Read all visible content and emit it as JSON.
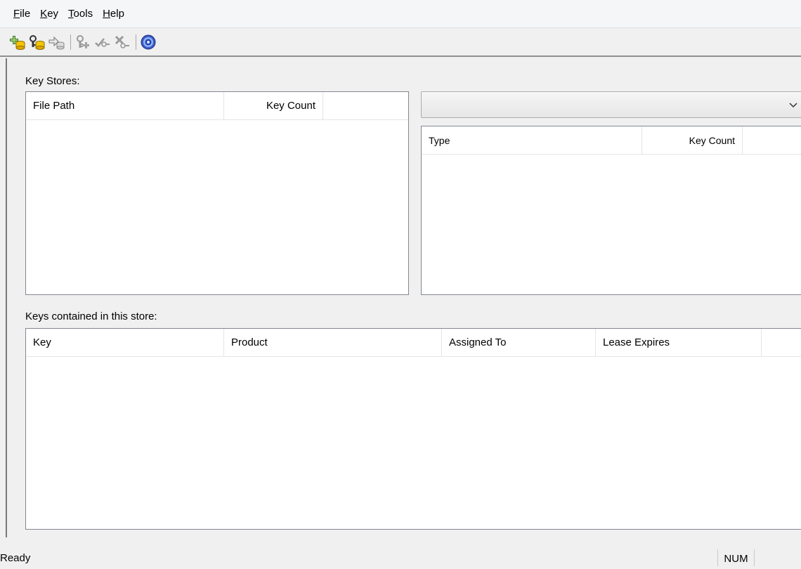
{
  "menu": {
    "items": [
      {
        "mnemonic": "F",
        "rest": "ile"
      },
      {
        "mnemonic": "K",
        "rest": "ey"
      },
      {
        "mnemonic": "T",
        "rest": "ools"
      },
      {
        "mnemonic": "H",
        "rest": "elp"
      }
    ]
  },
  "toolbar": {
    "buttons": [
      "new-key-store-icon",
      "open-key-store-icon",
      "import-key-store-icon",
      "add-key-icon",
      "edit-key-icon",
      "delete-key-icon",
      "help-icon"
    ]
  },
  "key_stores": {
    "label": "Key Stores:",
    "columns": [
      "File Path",
      "Key Count"
    ],
    "rows": []
  },
  "type_panel": {
    "combo_value": "",
    "columns": [
      "Type",
      "Key Count"
    ],
    "rows": []
  },
  "keys": {
    "label": "Keys contained in this store:",
    "columns": [
      "Key",
      "Product",
      "Assigned To",
      "Lease Expires"
    ],
    "rows": []
  },
  "status": {
    "text": "Ready",
    "num": "NUM"
  }
}
